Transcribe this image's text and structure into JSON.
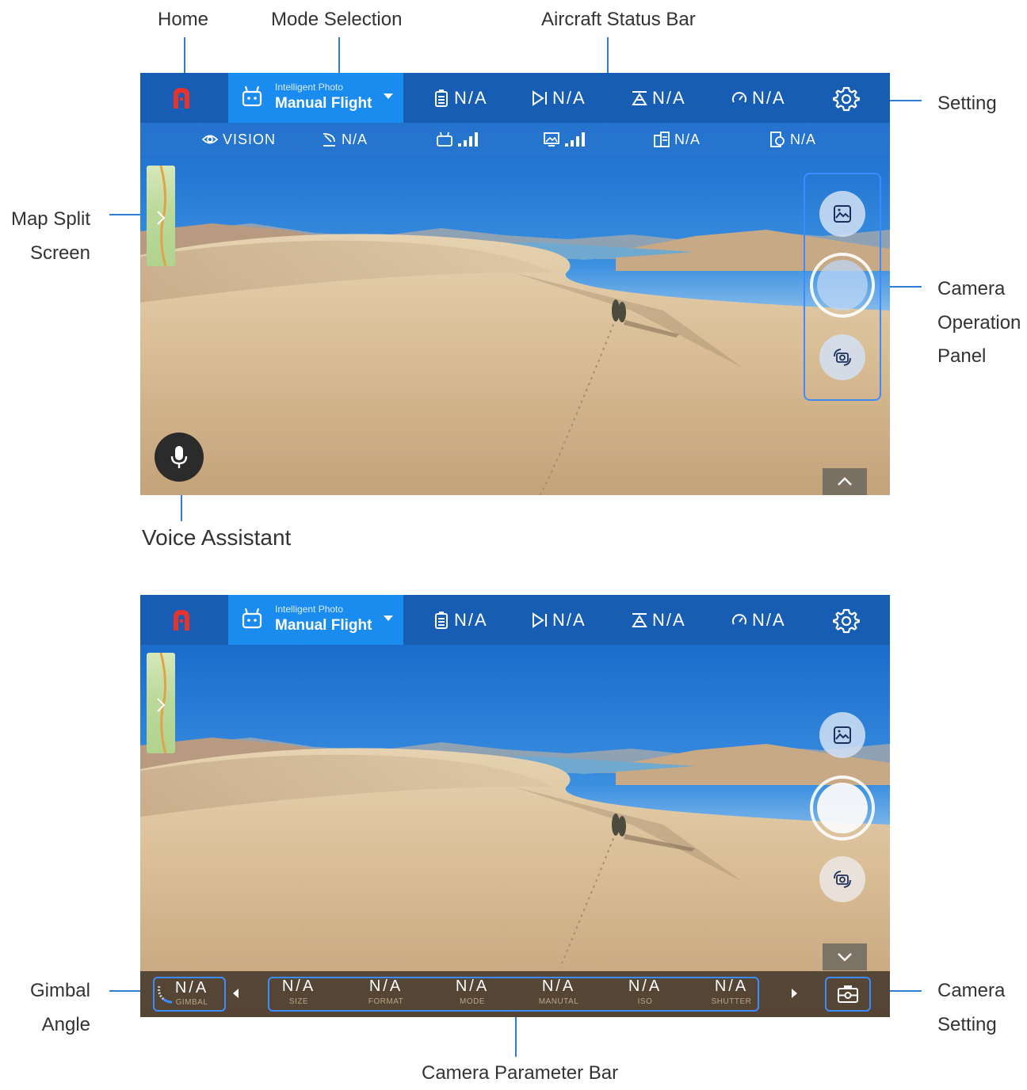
{
  "callouts": {
    "home": "Home",
    "mode_selection": "Mode Selection",
    "aircraft_status_bar": "Aircraft Status Bar",
    "setting": "Setting",
    "map_split_1": "Map Split",
    "map_split_2": "Screen",
    "camera_op_1": "Camera",
    "camera_op_2": "Operation",
    "camera_op_3": "Panel",
    "voice_assistant": "Voice Assistant",
    "gimbal_1": "Gimbal",
    "gimbal_2": "Angle",
    "camera_setting_1": "Camera",
    "camera_setting_2": "Setting",
    "camera_parameter_bar": "Camera Parameter Bar"
  },
  "topbar": {
    "mode_small": "Intelligent Photo",
    "mode_main": "Manual Flight",
    "stats": [
      {
        "icon": "battery-icon",
        "value": "N/A"
      },
      {
        "icon": "distance-icon",
        "value": "N/A"
      },
      {
        "icon": "altitude-icon",
        "value": "N/A"
      },
      {
        "icon": "speed-icon",
        "value": "N/A"
      }
    ]
  },
  "subbar": {
    "vision": "VISION",
    "gps": "N/A",
    "rc_signal": "",
    "image_signal": "",
    "rc_battery": "N/A",
    "camera_storage": "N/A"
  },
  "params": {
    "gimbal_value": "N/A",
    "gimbal_label": "GIMBAL",
    "items": [
      {
        "value": "N/A",
        "label": "SIZE"
      },
      {
        "value": "N/A",
        "label": "FORMAT"
      },
      {
        "value": "N/A",
        "label": "MODE"
      },
      {
        "value": "N/A",
        "label": "MANUTAL"
      },
      {
        "value": "N/A",
        "label": "ISO"
      },
      {
        "value": "N/A",
        "label": "SHUTTER"
      }
    ]
  },
  "colors": {
    "accent": "#1a8cf0",
    "topbar": "#185cb2",
    "callout_line": "#2e7cd6",
    "home_icon": "#e8322c"
  }
}
